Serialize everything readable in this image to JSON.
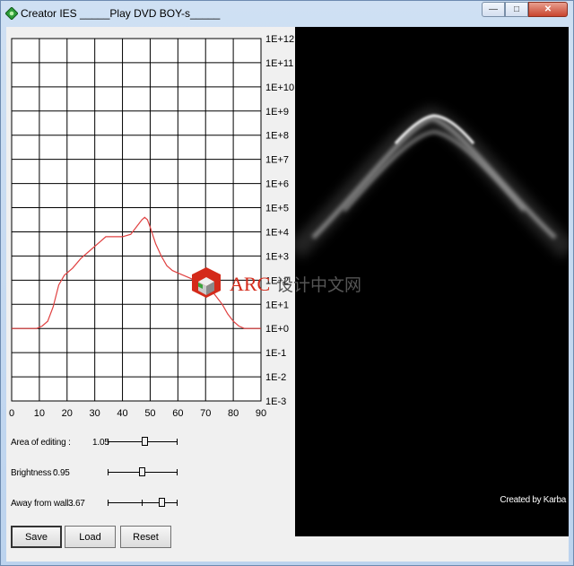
{
  "window": {
    "title": "Creator IES _____Play DVD BOY-s_____"
  },
  "chart_data": {
    "type": "line",
    "x_ticks": [
      "0",
      "10",
      "20",
      "30",
      "40",
      "50",
      "60",
      "70",
      "80",
      "90"
    ],
    "y_ticks": [
      "1E-3",
      "1E-2",
      "1E-1",
      "1E+0",
      "1E+1",
      "1E+2",
      "1E+3",
      "1E+4",
      "1E+5",
      "1E+6",
      "1E+7",
      "1E+8",
      "1E+9",
      "1E+10",
      "1E+11",
      "1E+12"
    ],
    "xlim": [
      0,
      90
    ],
    "ylim": [
      -3,
      12
    ],
    "grid": true,
    "series": [
      {
        "color": "#e04040",
        "x": [
          0,
          9,
          11,
          13,
          15,
          17,
          19,
          22,
          25,
          28,
          31,
          34,
          37,
          40,
          43,
          45,
          47,
          48,
          49,
          50,
          52,
          54,
          56,
          58,
          60,
          62,
          64,
          66,
          68,
          70,
          72,
          74,
          76,
          78,
          80,
          82,
          84,
          86,
          90
        ],
        "y": [
          0,
          0,
          0.1,
          0.3,
          0.9,
          1.8,
          2.2,
          2.5,
          2.9,
          3.2,
          3.5,
          3.8,
          3.8,
          3.8,
          3.9,
          4.2,
          4.5,
          4.6,
          4.5,
          4.2,
          3.5,
          3.0,
          2.6,
          2.4,
          2.3,
          2.2,
          2.1,
          2.0,
          1.9,
          1.8,
          1.6,
          1.3,
          1.0,
          0.6,
          0.3,
          0.1,
          0,
          0,
          0
        ]
      }
    ]
  },
  "controls": {
    "area": {
      "label": "Area of editing :",
      "value": "1.05",
      "position": 0.53
    },
    "brightness": {
      "label": "Brightness :",
      "value": "0.95",
      "position": 0.49
    },
    "away": {
      "label": "Away from wall :",
      "value": "3.67",
      "position": 0.78
    }
  },
  "buttons": {
    "save": "Save",
    "load": "Load",
    "reset": "Reset"
  },
  "preview": {
    "credit": "Created by Karba"
  },
  "watermark": {
    "text": "ARC 设计中文网",
    "brand": "ARC",
    "rest": "设计中文网"
  }
}
